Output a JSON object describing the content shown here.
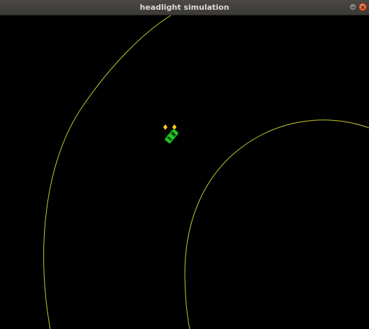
{
  "window": {
    "title": "headlight simulation"
  },
  "scene": {
    "background_color": "#000000",
    "track_color": "#c8c832",
    "car_color": "#22cc22",
    "headlight_color": "#ffd21f"
  },
  "icons": {
    "minimize": "minimize-icon",
    "close": "close-icon"
  }
}
